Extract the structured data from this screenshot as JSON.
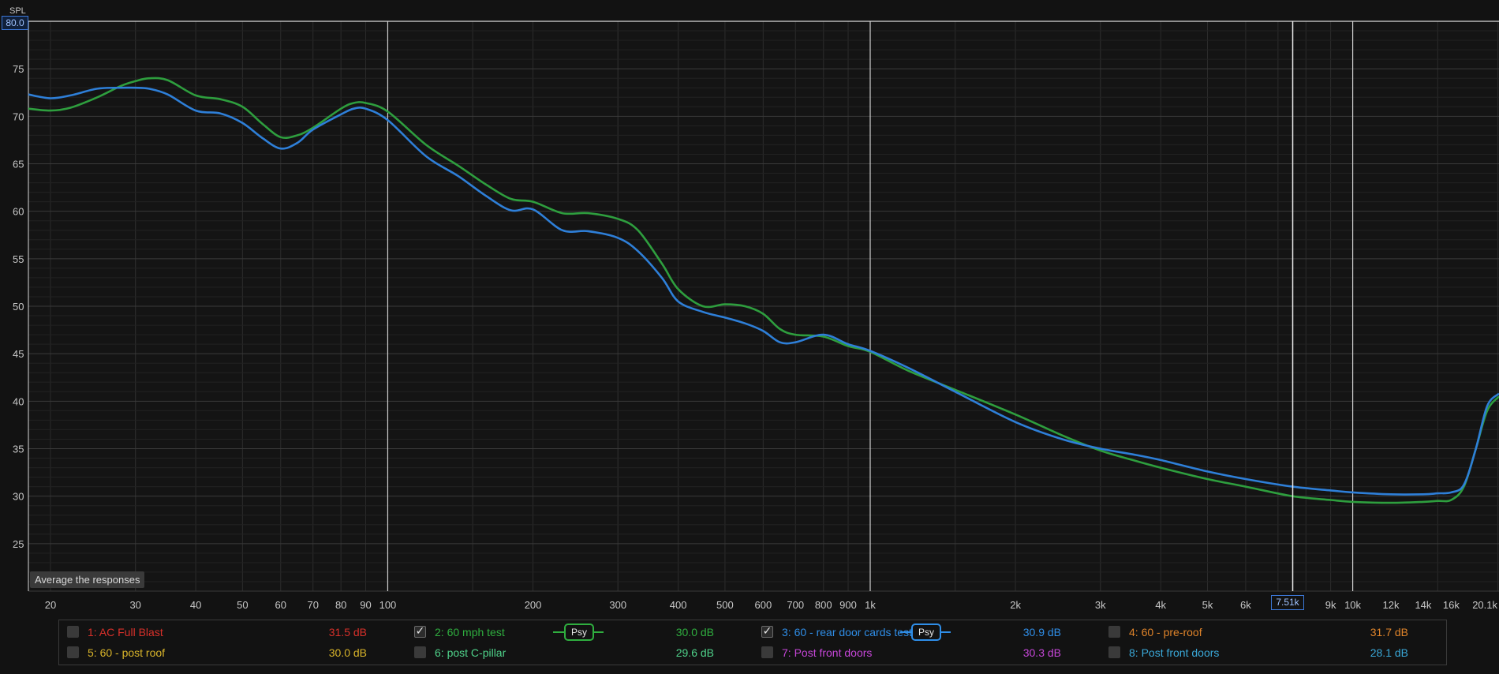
{
  "chart_data": {
    "type": "line",
    "ylabel": "SPL",
    "y_cursor_value": "80.0",
    "x_cursor_value": "7.51k",
    "ylim": [
      20,
      80
    ],
    "xlim": [
      18,
      20100
    ],
    "x_scale": "log",
    "grid": true,
    "y_ticks": [
      25,
      30,
      35,
      40,
      45,
      50,
      55,
      60,
      65,
      70,
      75
    ],
    "y_tick_labels": [
      "25",
      "30",
      "35",
      "40",
      "45",
      "50",
      "55",
      "60",
      "65",
      "70",
      "75"
    ],
    "x_ticks": [
      20,
      30,
      40,
      50,
      60,
      70,
      80,
      90,
      100,
      200,
      300,
      400,
      500,
      600,
      700,
      800,
      900,
      1000,
      2000,
      3000,
      4000,
      5000,
      6000,
      9000,
      10000,
      12000,
      14000,
      16000,
      20100
    ],
    "x_tick_labels": [
      "20",
      "30",
      "40",
      "50",
      "60",
      "70",
      "80",
      "90",
      "100",
      "200",
      "300",
      "400",
      "500",
      "600",
      "700",
      "800",
      "900",
      "1k",
      "2k",
      "3k",
      "4k",
      "5k",
      "6k",
      "9k",
      "10k",
      "12k",
      "14k",
      "16k",
      "20.1k"
    ],
    "x_major_lines": [
      100,
      1000,
      10000
    ],
    "cursor_x": 7510,
    "series": [
      {
        "name": "2: 60 mph test",
        "color": "#2e9e3e",
        "x": [
          18,
          20,
          22,
          25,
          28,
          30,
          32,
          35,
          40,
          45,
          50,
          55,
          60,
          65,
          70,
          80,
          85,
          90,
          100,
          120,
          140,
          160,
          180,
          200,
          230,
          260,
          300,
          330,
          370,
          400,
          450,
          500,
          550,
          600,
          650,
          700,
          800,
          900,
          1000,
          1200,
          1500,
          2000,
          2500,
          3000,
          3500,
          4000,
          5000,
          6000,
          7500,
          9000,
          10000,
          12000,
          14000,
          15000,
          16000,
          17000,
          18000,
          19000,
          20100
        ],
        "y": [
          70.8,
          70.6,
          70.9,
          72.0,
          73.2,
          73.7,
          74.0,
          73.8,
          72.2,
          71.8,
          71.0,
          69.2,
          67.8,
          68.0,
          68.8,
          70.8,
          71.4,
          71.4,
          70.5,
          67.0,
          64.8,
          62.8,
          61.3,
          61.0,
          59.8,
          59.8,
          59.2,
          58.0,
          54.5,
          51.8,
          50.0,
          50.2,
          50.0,
          49.2,
          47.6,
          47.0,
          46.8,
          45.8,
          45.2,
          43.2,
          41.2,
          38.6,
          36.4,
          34.8,
          33.8,
          33.0,
          31.8,
          31.0,
          30.0,
          29.6,
          29.4,
          29.3,
          29.4,
          29.5,
          29.6,
          31.0,
          35.0,
          39.0,
          40.5
        ]
      },
      {
        "name": "3: 60 - rear door cards test",
        "color": "#2e7fd8",
        "x": [
          18,
          20,
          22,
          25,
          28,
          30,
          32,
          35,
          40,
          45,
          50,
          55,
          60,
          65,
          70,
          80,
          85,
          90,
          100,
          120,
          140,
          160,
          180,
          200,
          230,
          260,
          300,
          330,
          370,
          400,
          450,
          500,
          550,
          600,
          650,
          700,
          800,
          900,
          1000,
          1200,
          1500,
          2000,
          2500,
          3000,
          3500,
          4000,
          5000,
          6000,
          7500,
          9000,
          10000,
          12000,
          14000,
          15000,
          16000,
          17000,
          18000,
          19000,
          20100
        ],
        "y": [
          72.3,
          71.9,
          72.2,
          72.9,
          73.0,
          73.0,
          72.9,
          72.3,
          70.6,
          70.3,
          69.3,
          67.7,
          66.6,
          67.2,
          68.6,
          70.2,
          70.8,
          70.8,
          69.6,
          65.8,
          63.7,
          61.6,
          60.1,
          60.2,
          58.0,
          57.9,
          57.2,
          55.8,
          53.0,
          50.5,
          49.4,
          48.8,
          48.2,
          47.4,
          46.2,
          46.2,
          47.0,
          46.0,
          45.3,
          43.5,
          41.0,
          37.8,
          36.0,
          35.0,
          34.4,
          33.8,
          32.6,
          31.8,
          31.0,
          30.6,
          30.4,
          30.2,
          30.2,
          30.3,
          30.4,
          31.2,
          35.0,
          39.5,
          40.8
        ]
      }
    ],
    "legend": [
      {
        "name": "1: AC Full Blast",
        "value": "31.5 dB",
        "checked": false,
        "color": "#d8302a",
        "psy": false
      },
      {
        "name": "2: 60 mph test",
        "value": "30.0 dB",
        "checked": true,
        "color": "#2fae3f",
        "psy": true,
        "psy_label": "Psy"
      },
      {
        "name": "3: 60 - rear door cards test",
        "value": "30.9 dB",
        "checked": true,
        "color": "#2f8ee8",
        "psy": true,
        "psy_label": "Psy"
      },
      {
        "name": "4: 60 - pre-roof",
        "value": "31.7 dB",
        "checked": false,
        "color": "#e0842a",
        "psy": false
      },
      {
        "name": "5: 60 - post roof",
        "value": "30.0 dB",
        "checked": false,
        "color": "#d8b42a",
        "psy": false
      },
      {
        "name": "6: post C-pillar",
        "value": "29.6 dB",
        "checked": false,
        "color": "#4fd28a",
        "psy": false
      },
      {
        "name": "7: Post front doors",
        "value": "30.3 dB",
        "checked": false,
        "color": "#c646d8",
        "psy": false
      },
      {
        "name": "8: Post front doors",
        "value": "28.1 dB",
        "checked": false,
        "color": "#3aa8d8",
        "psy": false
      }
    ]
  },
  "tooltip": "Average the responses"
}
